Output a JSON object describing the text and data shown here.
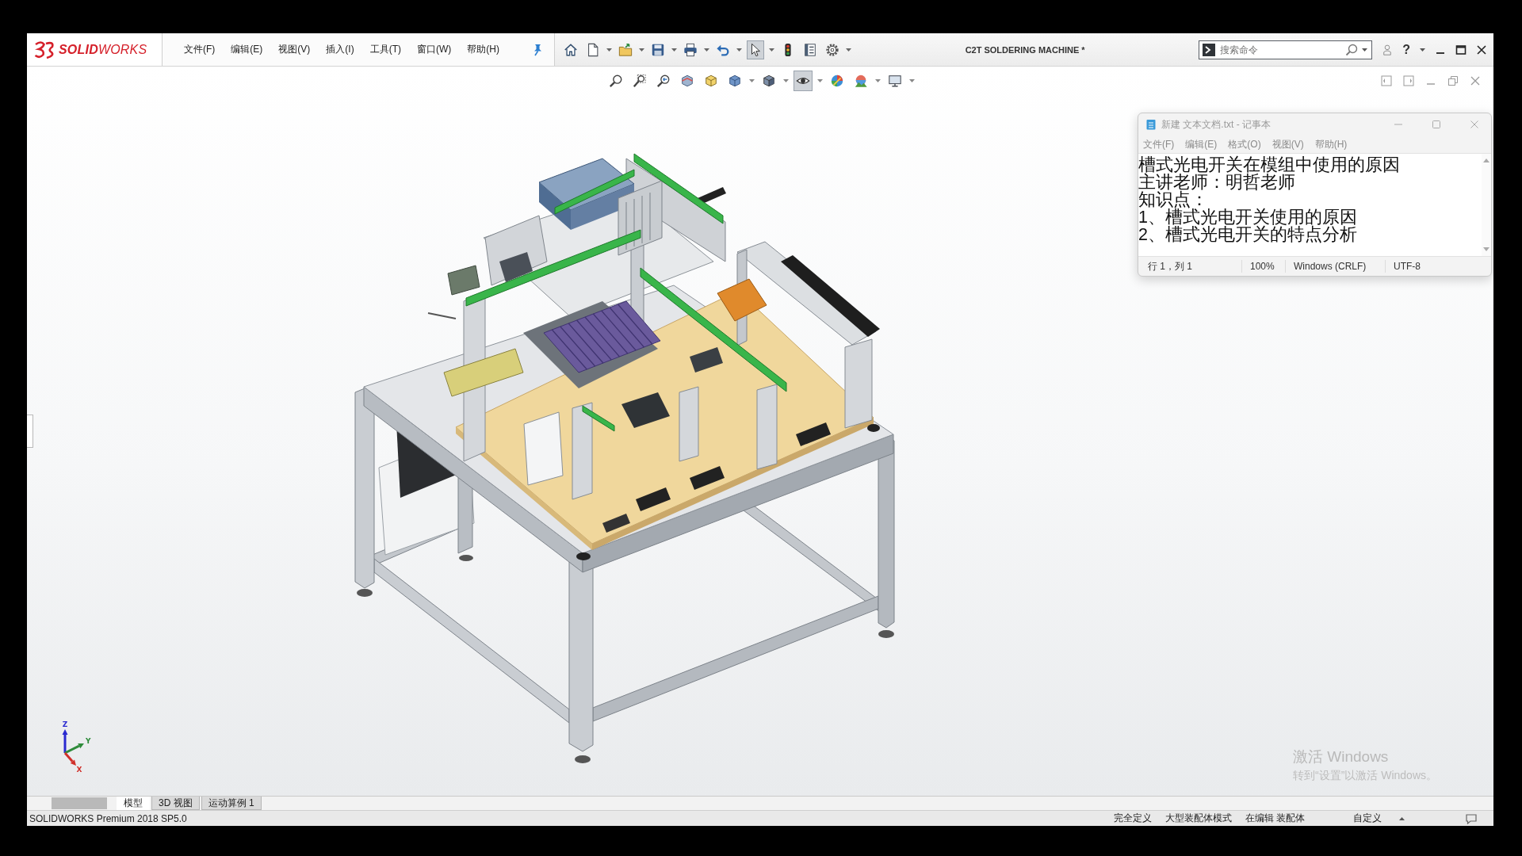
{
  "app": {
    "logo_text": "**SOLID**WORKS",
    "menus": [
      "文件(F)",
      "编辑(E)",
      "视图(V)",
      "插入(I)",
      "工具(T)",
      "窗口(W)",
      "帮助(H)"
    ],
    "toolbar": [
      {
        "kind": "home",
        "dropdown": false,
        "pressed": false
      },
      {
        "kind": "new",
        "dropdown": true,
        "pressed": false
      },
      {
        "kind": "open",
        "dropdown": true,
        "pressed": false
      },
      {
        "kind": "save",
        "dropdown": true,
        "pressed": false
      },
      {
        "kind": "print",
        "dropdown": true,
        "pressed": false
      },
      {
        "kind": "undo",
        "dropdown": true,
        "pressed": false
      },
      {
        "kind": "select",
        "dropdown": true,
        "pressed": true
      },
      {
        "kind": "rebuild",
        "dropdown": false,
        "pressed": false
      },
      {
        "kind": "properties",
        "dropdown": false,
        "pressed": false
      },
      {
        "kind": "options",
        "dropdown": true,
        "pressed": false
      }
    ],
    "document_title": "C2T SOLDERING MACHINE *",
    "search": {
      "placeholder": "搜索命令"
    },
    "help_label": "?"
  },
  "view_toolbar": [
    {
      "kind": "zoom-fit",
      "dropdown": false,
      "pressed": false
    },
    {
      "kind": "zoom-area",
      "dropdown": false,
      "pressed": false
    },
    {
      "kind": "previous-view",
      "dropdown": false,
      "pressed": false
    },
    {
      "kind": "section-view",
      "dropdown": false,
      "pressed": false
    },
    {
      "kind": "dynamic-annotation",
      "dropdown": false,
      "pressed": false
    },
    {
      "kind": "view-orientation",
      "dropdown": true,
      "pressed": false
    },
    {
      "kind": "display-style",
      "dropdown": true,
      "pressed": false
    },
    {
      "kind": "hide-show",
      "dropdown": true,
      "pressed": true
    },
    {
      "kind": "appearance",
      "dropdown": false,
      "pressed": false
    },
    {
      "kind": "scene",
      "dropdown": true,
      "pressed": false
    },
    {
      "kind": "view-settings",
      "dropdown": true,
      "pressed": false
    }
  ],
  "viewport": {
    "triad": {
      "axes": [
        {
          "label": "Z",
          "color": "#2a2ad0"
        },
        {
          "label": "Y",
          "color": "#2e8b3a"
        },
        {
          "label": "X",
          "color": "#d0302a"
        }
      ]
    }
  },
  "notepad": {
    "title": "新建 文本文档.txt - 记事本",
    "menus": [
      "文件(F)",
      "编辑(E)",
      "格式(O)",
      "视图(V)",
      "帮助(H)"
    ],
    "lines": [
      "槽式光电开关在模组中使用的原因",
      "主讲老师：明哲老师",
      "知识点：",
      "1、槽式光电开关使用的原因",
      "2、槽式光电开关的特点分析"
    ],
    "status": [
      "行 1，列 1",
      "100%",
      "Windows (CRLF)",
      "UTF-8"
    ]
  },
  "activation_notice": {
    "title": "激活 Windows",
    "message": "转到“设置”以激活 Windows。"
  },
  "document_tabs": [
    {
      "label": "模型",
      "selected": true
    },
    {
      "label": "3D 视图",
      "selected": false
    },
    {
      "label": "运动算例 1",
      "selected": false
    }
  ],
  "status_bar": {
    "product": "SOLIDWORKS Premium 2018 SP5.0",
    "fields": [
      "完全定义",
      "大型装配体模式",
      "在编辑 装配体",
      "自定义"
    ]
  }
}
